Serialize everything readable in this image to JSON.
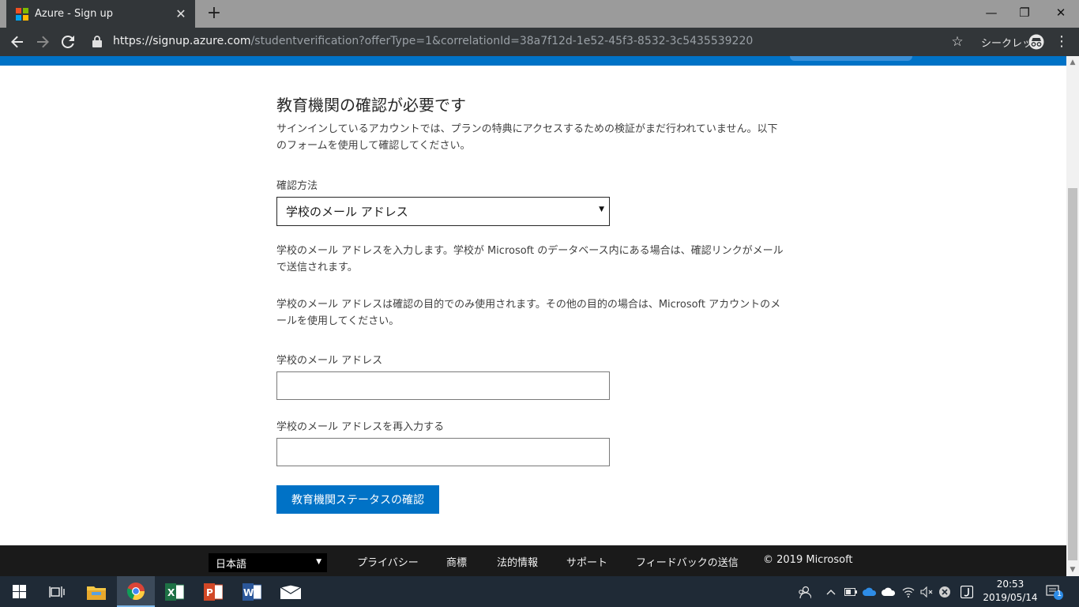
{
  "browser": {
    "tab_title": "Azure - Sign up",
    "tab_close": "✕",
    "new_tab": "+",
    "url_scheme": "https://",
    "url_host": "signup.azure.com",
    "url_rest": "/studentverification?offerType=1&correlationId=38a7f12d-1e52-45f3-8532-3c5435539220",
    "incognito_label": "シークレット",
    "window_minimize": "—",
    "window_restore": "❐",
    "window_close": "✕"
  },
  "form": {
    "heading": "教育機関の確認が必要です",
    "intro": "サインインしているアカウントでは、プランの特典にアクセスするための検証がまだ行われていません。以下のフォームを使用して確認してください。",
    "method_label": "確認方法",
    "method_selected": "学校のメール アドレス",
    "info_1": "学校のメール アドレスを入力します。学校が Microsoft のデータベース内にある場合は、確認リンクがメールで送信されます。",
    "info_2": "学校のメール アドレスは確認の目的でのみ使用されます。その他の目的の場合は、Microsoft アカウントのメールを使用してください。",
    "email_label": "学校のメール アドレス",
    "email_value": "",
    "email_confirm_label": "学校のメール アドレスを再入力する",
    "email_confirm_value": "",
    "submit_label": "教育機関ステータスの確認"
  },
  "footer": {
    "language": "日本語",
    "links": [
      "プライバシー",
      "商標",
      "法的情報",
      "サポート",
      "フィードバックの送信"
    ],
    "copyright": "© 2019 Microsoft"
  },
  "taskbar": {
    "apps": [
      "start-icon",
      "task-view-icon",
      "file-explorer-icon",
      "chrome-icon",
      "excel-icon",
      "powerpoint-icon",
      "word-icon",
      "mail-icon"
    ],
    "time": "20:53",
    "date": "2019/05/14",
    "notification_count": "1"
  },
  "colors": {
    "accent": "#0072c6",
    "footer_bg": "#1a1a1a",
    "chrome_toolbar": "#323639",
    "taskbar_bg": "#1f2a36"
  }
}
